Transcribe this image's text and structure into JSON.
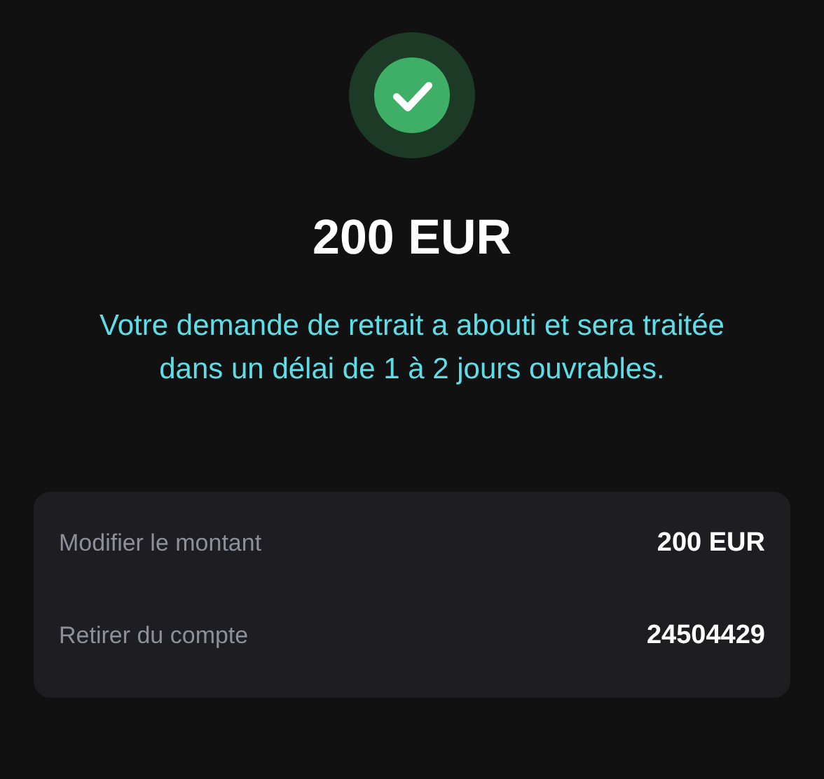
{
  "status": {
    "kind": "success"
  },
  "amount": "200 EUR",
  "message": "Votre demande de retrait a abouti et sera traitée dans un délai de 1 à 2 jours ouvrables.",
  "details": [
    {
      "label": "Modifier le montant",
      "value": "200 EUR"
    },
    {
      "label": "Retirer du compte",
      "value": "24504429"
    }
  ]
}
